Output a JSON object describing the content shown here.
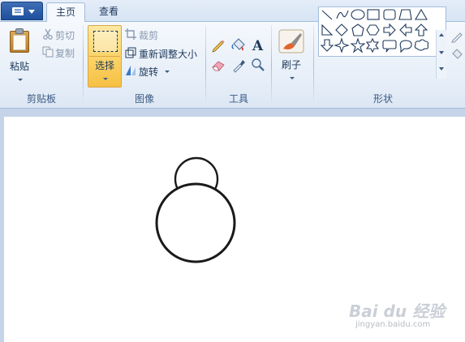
{
  "tabs": [
    {
      "label": "主页",
      "active": true
    },
    {
      "label": "查看",
      "active": false
    }
  ],
  "clipboard": {
    "paste_label": "粘贴",
    "cut_label": "剪切",
    "copy_label": "复制",
    "group_label": "剪贴板"
  },
  "image": {
    "select_label": "选择",
    "crop_label": "裁剪",
    "resize_label": "重新调整大小",
    "rotate_label": "旋转",
    "group_label": "图像"
  },
  "tools": {
    "group_label": "工具",
    "items": [
      "pencil-icon",
      "fill-bucket-icon",
      "text-icon",
      "eraser-icon",
      "color-picker-icon",
      "magnifier-icon"
    ],
    "text_tool_glyph": "A"
  },
  "brushes": {
    "label": "刷子"
  },
  "shapes": {
    "group_label": "形状",
    "items": [
      "line-shape-icon",
      "curve-shape-icon",
      "oval-shape-icon",
      "rectangle-shape-icon",
      "rounded-rectangle-shape-icon",
      "polygon-shape-icon",
      "triangle-shape-icon",
      "right-triangle-shape-icon",
      "diamond-shape-icon",
      "pentagon-shape-icon",
      "hexagon-shape-icon",
      "right-arrow-shape-icon",
      "left-arrow-shape-icon",
      "up-arrow-shape-icon",
      "down-arrow-shape-icon",
      "four-point-star-shape-icon",
      "five-point-star-shape-icon",
      "six-point-star-shape-icon",
      "rounded-callout-shape-icon",
      "oval-callout-shape-icon",
      "cloud-callout-shape-icon"
    ]
  },
  "watermark": {
    "text": "Bai du 经验",
    "url": "jingyan.baidu.com"
  },
  "colors": {
    "ribbon_bg": "#e6eef8",
    "select_highlight": "#fbd56b",
    "workspace_bg": "#c5d4e8",
    "ink": "#1e395b"
  }
}
